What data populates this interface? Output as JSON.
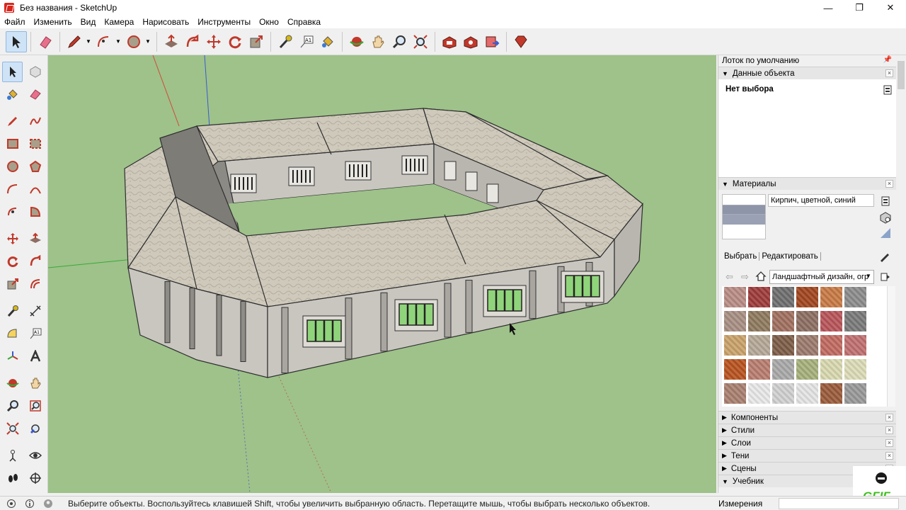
{
  "window": {
    "title": "Без названия - SketchUp",
    "controls": [
      "minimize-icon",
      "restore-icon",
      "close-icon"
    ]
  },
  "menu": [
    "Файл",
    "Изменить",
    "Вид",
    "Камера",
    "Нарисовать",
    "Инструменты",
    "Окно",
    "Справка"
  ],
  "toolbar": {
    "tools": [
      "select",
      "eraser",
      "pencil",
      "arc",
      "shapes",
      "push-pull",
      "follow-me",
      "move",
      "rotate",
      "scale",
      "tape-measure",
      "text",
      "paint-bucket",
      "orbit",
      "pan",
      "zoom",
      "zoom-extents",
      "3d-warehouse",
      "extension-warehouse",
      "layout",
      "ruby-console"
    ],
    "active": "select"
  },
  "left_tools": [
    "select",
    "component",
    "paint",
    "eraser",
    "line",
    "freehand",
    "rectangle",
    "rotated-rectangle",
    "circle",
    "polygon",
    "arc",
    "arc-2",
    "pie",
    "arc-3",
    "move",
    "push-pull",
    "rotate",
    "follow-me",
    "scale",
    "offset",
    "tape-measure",
    "dimension",
    "protractor",
    "text",
    "axes",
    "3d-text",
    "orbit",
    "pan",
    "zoom",
    "zoom-window",
    "zoom-extents",
    "previous",
    "position-camera",
    "look-around",
    "walk",
    "section-plane"
  ],
  "tray": {
    "title": "Лоток по умолчанию",
    "entity_info": {
      "title": "Данные объекта",
      "selection": "Нет выбора"
    },
    "materials": {
      "title": "Материалы",
      "current_name": "Кирпич, цветной, синий",
      "tabs": [
        "Выбрать",
        "Редактировать"
      ],
      "library": "Ландшафтный дизайн, огр",
      "swatches": [
        [
          "#b88d85",
          "#9d3b3b",
          "#6e6e6e",
          "#a0461f",
          "#c87a45",
          "#8c8c8c"
        ],
        [
          "#a88f83",
          "#8e7a5e",
          "#a07060",
          "#8d6e63",
          "#b8555a",
          "#7a7a7a"
        ],
        [
          "#c9a26a",
          "#b5a898",
          "#7d5d48",
          "#9b7b6d",
          "#c06a61",
          "#c07070"
        ],
        [
          "#b8531f",
          "#b97d70",
          "#a9a9a9",
          "#a5b07b",
          "#d8d8b0",
          "#dcdcb8"
        ],
        [
          "#a88070",
          "#e8e8e8",
          "#d0d0d0",
          "#e4e4e4",
          "#9b5b3b",
          "#999999"
        ],
        [
          "#c66060",
          "#d0d0d0",
          "#b0b0b0",
          "#5da84a",
          "#d9c89a",
          "#c87060"
        ]
      ]
    },
    "collapsed_panels": [
      "Компоненты",
      "Стили",
      "Слои",
      "Тени",
      "Сцены",
      "Учебник"
    ]
  },
  "status": {
    "message": "Выберите объекты. Воспользуйтесь клавишей Shift, чтобы увеличить выбранную область. Перетащите мышь, чтобы выбрать несколько объектов.",
    "measurements_label": "Измерения",
    "measurements_value": ""
  },
  "watermark": "GFIF",
  "colors": {
    "viewport_bg": "#9ec28a",
    "roof": "#cfc9bc",
    "wall": "#c9c6c0",
    "window_glass": "#8fd47a",
    "axis_red": "#d24a3a",
    "axis_green": "#3aa83a",
    "axis_blue": "#3a5ad2"
  }
}
